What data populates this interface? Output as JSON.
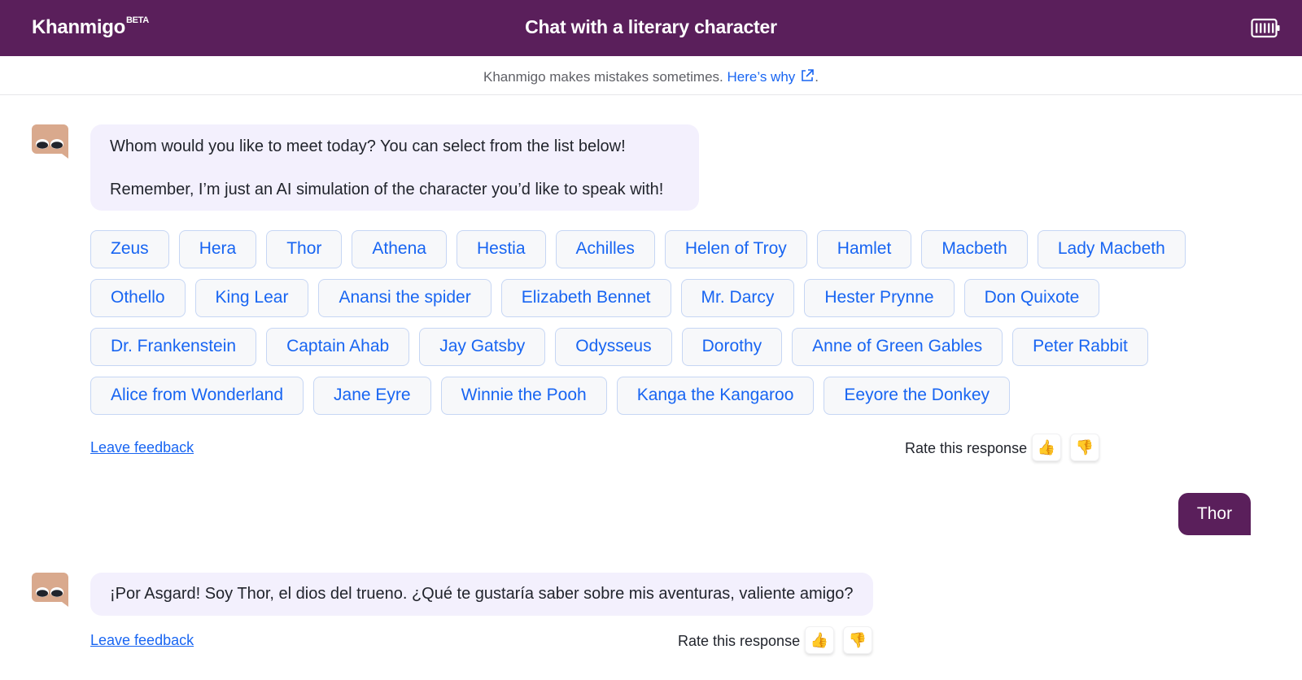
{
  "header": {
    "brand": "Khanmigo",
    "brand_badge": "BETA",
    "title": "Chat with a literary character",
    "menu_icon": "battery-menu-icon"
  },
  "disclaimer": {
    "text": "Khanmigo makes mistakes sometimes.",
    "link": "Here’s why",
    "suffix": ".",
    "link_icon": "external-link-icon"
  },
  "messages": {
    "intro": {
      "line1": "Whom would you like to meet today? You can select from the list below!",
      "line2": "Remember, I’m just an AI simulation of the character you’d like to speak with!"
    },
    "characters": [
      [
        "Zeus",
        "Hera",
        "Thor",
        "Athena",
        "Hestia",
        "Achilles",
        "Helen of Troy",
        "Hamlet",
        "Macbeth",
        "Lady Macbeth"
      ],
      [
        "Othello",
        "King Lear",
        "Anansi the spider",
        "Elizabeth Bennet",
        "Mr. Darcy",
        "Hester Prynne",
        "Don Quixote"
      ],
      [
        "Dr. Frankenstein",
        "Captain Ahab",
        "Jay Gatsby",
        "Odysseus",
        "Dorothy",
        "Anne of Green Gables",
        "Peter Rabbit"
      ],
      [
        "Alice from Wonderland",
        "Jane Eyre",
        "Winnie the Pooh",
        "Kanga the Kangaroo",
        "Eeyore the Donkey"
      ]
    ],
    "feedback_link": "Leave feedback",
    "rate_label": "Rate this response",
    "thumbs_up": "👍",
    "thumbs_down": "👎",
    "user_reply": "Thor",
    "thor_reply": "¡Por Asgard! Soy Thor, el dios del trueno. ¿Qué te gustaría saber sobre mis aventuras, valiente amigo?"
  },
  "colors": {
    "header_bg": "#5a1f5b",
    "link_blue": "#1865f2",
    "bot_bubble": "#f3f0fd",
    "user_bubble": "#5a1f5b"
  }
}
